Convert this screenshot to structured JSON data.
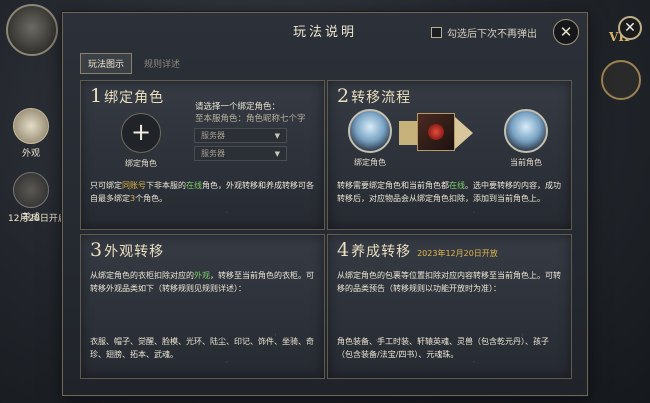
{
  "background": {
    "side_button_1_label": "外观",
    "side_button_2_label": "养成",
    "date_label": "12月20日开启",
    "vip_label": "VIP",
    "close_glyph": "✕"
  },
  "dialog": {
    "title": "玩法说明",
    "no_popup_label": "勾选后下次不再弹出",
    "close_glyph": "✕",
    "tabs": [
      {
        "label": "玩法图示",
        "active": true
      },
      {
        "label": "规则详述",
        "active": false
      }
    ]
  },
  "panels": [
    {
      "num": "1",
      "title": "绑定角色",
      "add_glyph": "+",
      "add_label": "绑定角色",
      "select_hint": "请选择一个绑定角色：",
      "select_sub": "至本服角色：角色昵称七个字",
      "selects": [
        "服务器",
        "服务器"
      ],
      "desc_pre": "只可绑定",
      "desc_hl1": "同账号",
      "desc_mid1": "下非本服的",
      "desc_hl2": "在线",
      "desc_mid2": "角色，外观转移和养成转移可各自最多绑定",
      "desc_hl3": "3",
      "desc_post": "个角色。"
    },
    {
      "num": "2",
      "title": "转移流程",
      "left_label": "绑定角色",
      "right_label": "当前角色",
      "desc_pre": "转移需要绑定角色和当前角色都",
      "desc_hl1": "在线",
      "desc_post": "。选中要转移的内容，成功转移后，对应物品会从绑定角色扣除，添加到当前角色上。"
    },
    {
      "num": "3",
      "title": "外观转移",
      "desc_pre": "从绑定角色的衣柜扣除对应的",
      "desc_hl1": "外观",
      "desc_post": "，转移至当前角色的衣柜。可转移外观品类如下（转移规则见规则详述）：",
      "list": "衣服、帽子、觉醒、脸模、光环、陆尘、印记、饰件、坐骑、奇珍、翅膀、拓本、武魂。"
    },
    {
      "num": "4",
      "title": "养成转移",
      "note": "2023年12月20日开放",
      "desc": "从绑定角色的包裹等位置扣除对应内容转移至当前角色上。可转移的品类预告（转移规则以功能开放时为准）：",
      "list": "角色装备、手工时装、轩辕英魂、灵兽（包含乾元丹）、孩子（包含装备/法宝/四书）、元魂珠。"
    }
  ]
}
